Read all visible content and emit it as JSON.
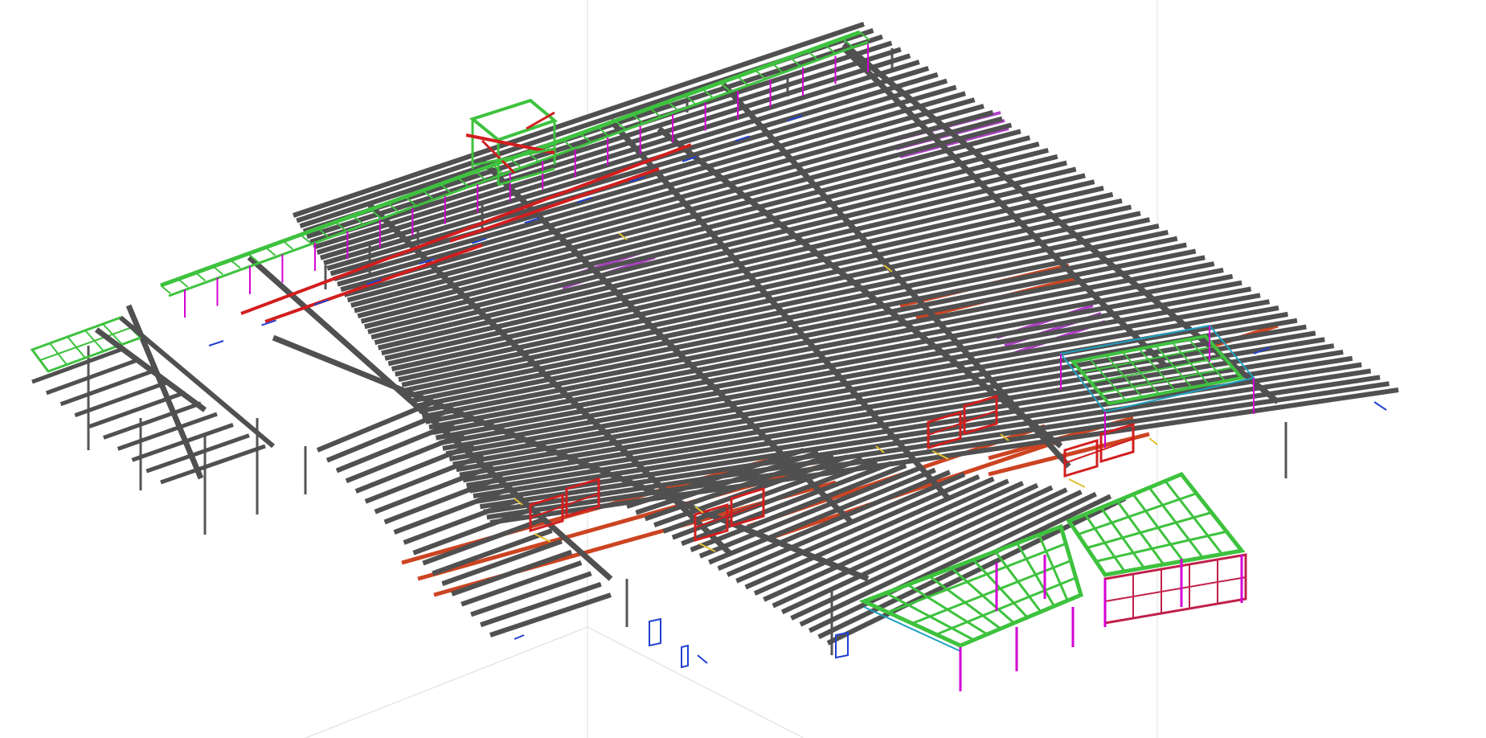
{
  "view": {
    "background": "#ffffff",
    "grid_line_color": "#d8e6da",
    "ground_line_color": "#e6e6e6"
  },
  "colors": {
    "steel_beam": "#505050",
    "steel_column": "#555555",
    "green_framing": "#3ec23e",
    "red_framing": "#d21e1e",
    "orange_red_members": "#cc4422",
    "purple_members": "#b040c8",
    "magenta_posts": "#d400d4",
    "blue_members": "#2040d0",
    "cyan_members": "#20a0c0",
    "crimson_frame": "#c0204a",
    "yellow_connections": "#e0c030"
  },
  "model": {
    "object_type": "3D structural steel model"
  }
}
